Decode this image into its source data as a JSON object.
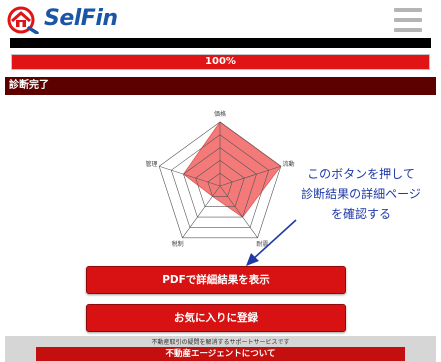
{
  "header": {
    "logo_text": "SelFin",
    "brand_color": "#1b56a6",
    "menu_icon": "hamburger-menu-icon"
  },
  "progress": {
    "label": "100%",
    "value": 1.0,
    "fill_color": "#e01414"
  },
  "status": {
    "label": "診断完了",
    "bar_color": "#5d0000"
  },
  "chart_data": {
    "type": "radar",
    "axes": [
      "価格",
      "流動",
      "耐震",
      "税制",
      "管理"
    ],
    "max": 5,
    "levels": 5,
    "values": [
      5,
      5,
      3,
      1,
      3
    ],
    "fill_color": "#f47a7a"
  },
  "annotation": {
    "lines": [
      "このボタンを押して",
      "診断結果の詳細ページ",
      "を確認する"
    ],
    "color": "#1f3aa8"
  },
  "buttons": {
    "pdf_label": "PDFで詳細結果を表示",
    "favorite_label": "お気に入りに登録"
  },
  "footer": {
    "note": "不動産取引の疑問を解消するサポートサービスです",
    "agent_label": "不動産エージェントについて"
  }
}
